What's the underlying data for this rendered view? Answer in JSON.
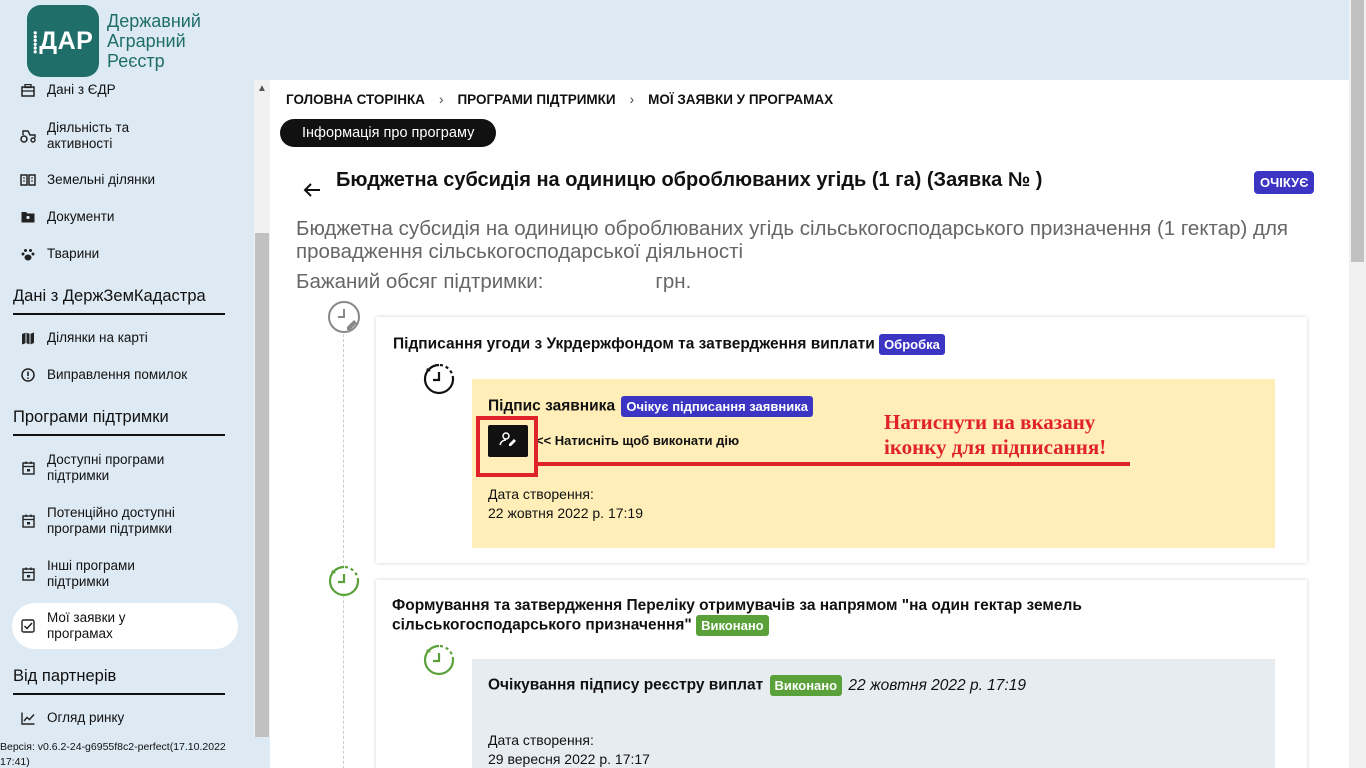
{
  "logo": {
    "badge": "ДАР",
    "line1": "Державний",
    "line2": "Аграрний",
    "line3": "Реєстр"
  },
  "sidebar": {
    "items_top": [
      {
        "label": "Дані з ЄДР"
      },
      {
        "label": "Діяльність та активності"
      },
      {
        "label": "Земельні ділянки"
      },
      {
        "label": "Документи"
      },
      {
        "label": "Тварини"
      }
    ],
    "section_dzk": "Дані з ДержЗемКадастра",
    "items_dzk": [
      {
        "label": "Ділянки на карті"
      },
      {
        "label": "Виправлення помилок"
      }
    ],
    "section_programs": "Програми підтримки",
    "items_programs": [
      {
        "label": "Доступні програми підтримки"
      },
      {
        "label": "Потенційно доступні програми підтримки"
      },
      {
        "label": "Інші програми підтримки"
      },
      {
        "label": "Мої заявки у програмах"
      }
    ],
    "section_partners": "Від партнерів",
    "items_partners": [
      {
        "label": "Огляд ринку"
      }
    ],
    "version": "Версія: v0.6.2-24-g6955f8c2-perfect(17.10.2022 17:41)"
  },
  "breadcrumb": {
    "home": "ГОЛОВНА СТОРІНКА",
    "programs": "ПРОГРАМИ ПІДТРИМКИ",
    "my_requests": "МОЇ ЗАЯВКИ У ПРОГРАМАХ",
    "separator": "›"
  },
  "info_button": "Інформація про програму",
  "page": {
    "title": "Бюджетна субсидія на одиницю оброблюваних угідь (1 га) (Заявка № )",
    "status": "ОЧІКУЄ",
    "subtitle": "Бюджетна субсидія на одиницю оброблюваних угідь сільськогосподарського призначення (1 гектар) для провадження сільськогосподарської діяльності",
    "amount_label": "Бажаний обсяг підтримки:",
    "amount_currency": "грн."
  },
  "stages": [
    {
      "title": "Підписання угоди з Укрдержфондом та затвердження виплати",
      "status": "Обробка",
      "step": {
        "title": "Підпис заявника",
        "status": "Очікує підписання заявника",
        "hint": "<< Натисніть щоб виконати дію",
        "date_label": "Дата створення:",
        "date": "22 жовтня 2022 р. 17:19"
      }
    },
    {
      "title": "Формування та затвердження Переліку отримувачів за напрямом \"на один гектар земель сільськогосподарського призначення\"",
      "status": "Виконано",
      "step": {
        "title": "Очікування підпису реєстру виплат",
        "status": "Виконано",
        "timestamp": "22 жовтня 2022 р. 17:19",
        "date_label": "Дата створення:",
        "date": "29 вересня 2022 р. 17:17"
      }
    }
  ],
  "annotation": {
    "line1": "Натиснути на вказану",
    "line2": "іконку для підписання!"
  },
  "colors": {
    "brand": "#1f6e6a",
    "status_blue": "#3c35c4",
    "status_green": "#5aa13a",
    "annotation_red": "#e0232a",
    "step_yellow": "#ffeeb8"
  }
}
